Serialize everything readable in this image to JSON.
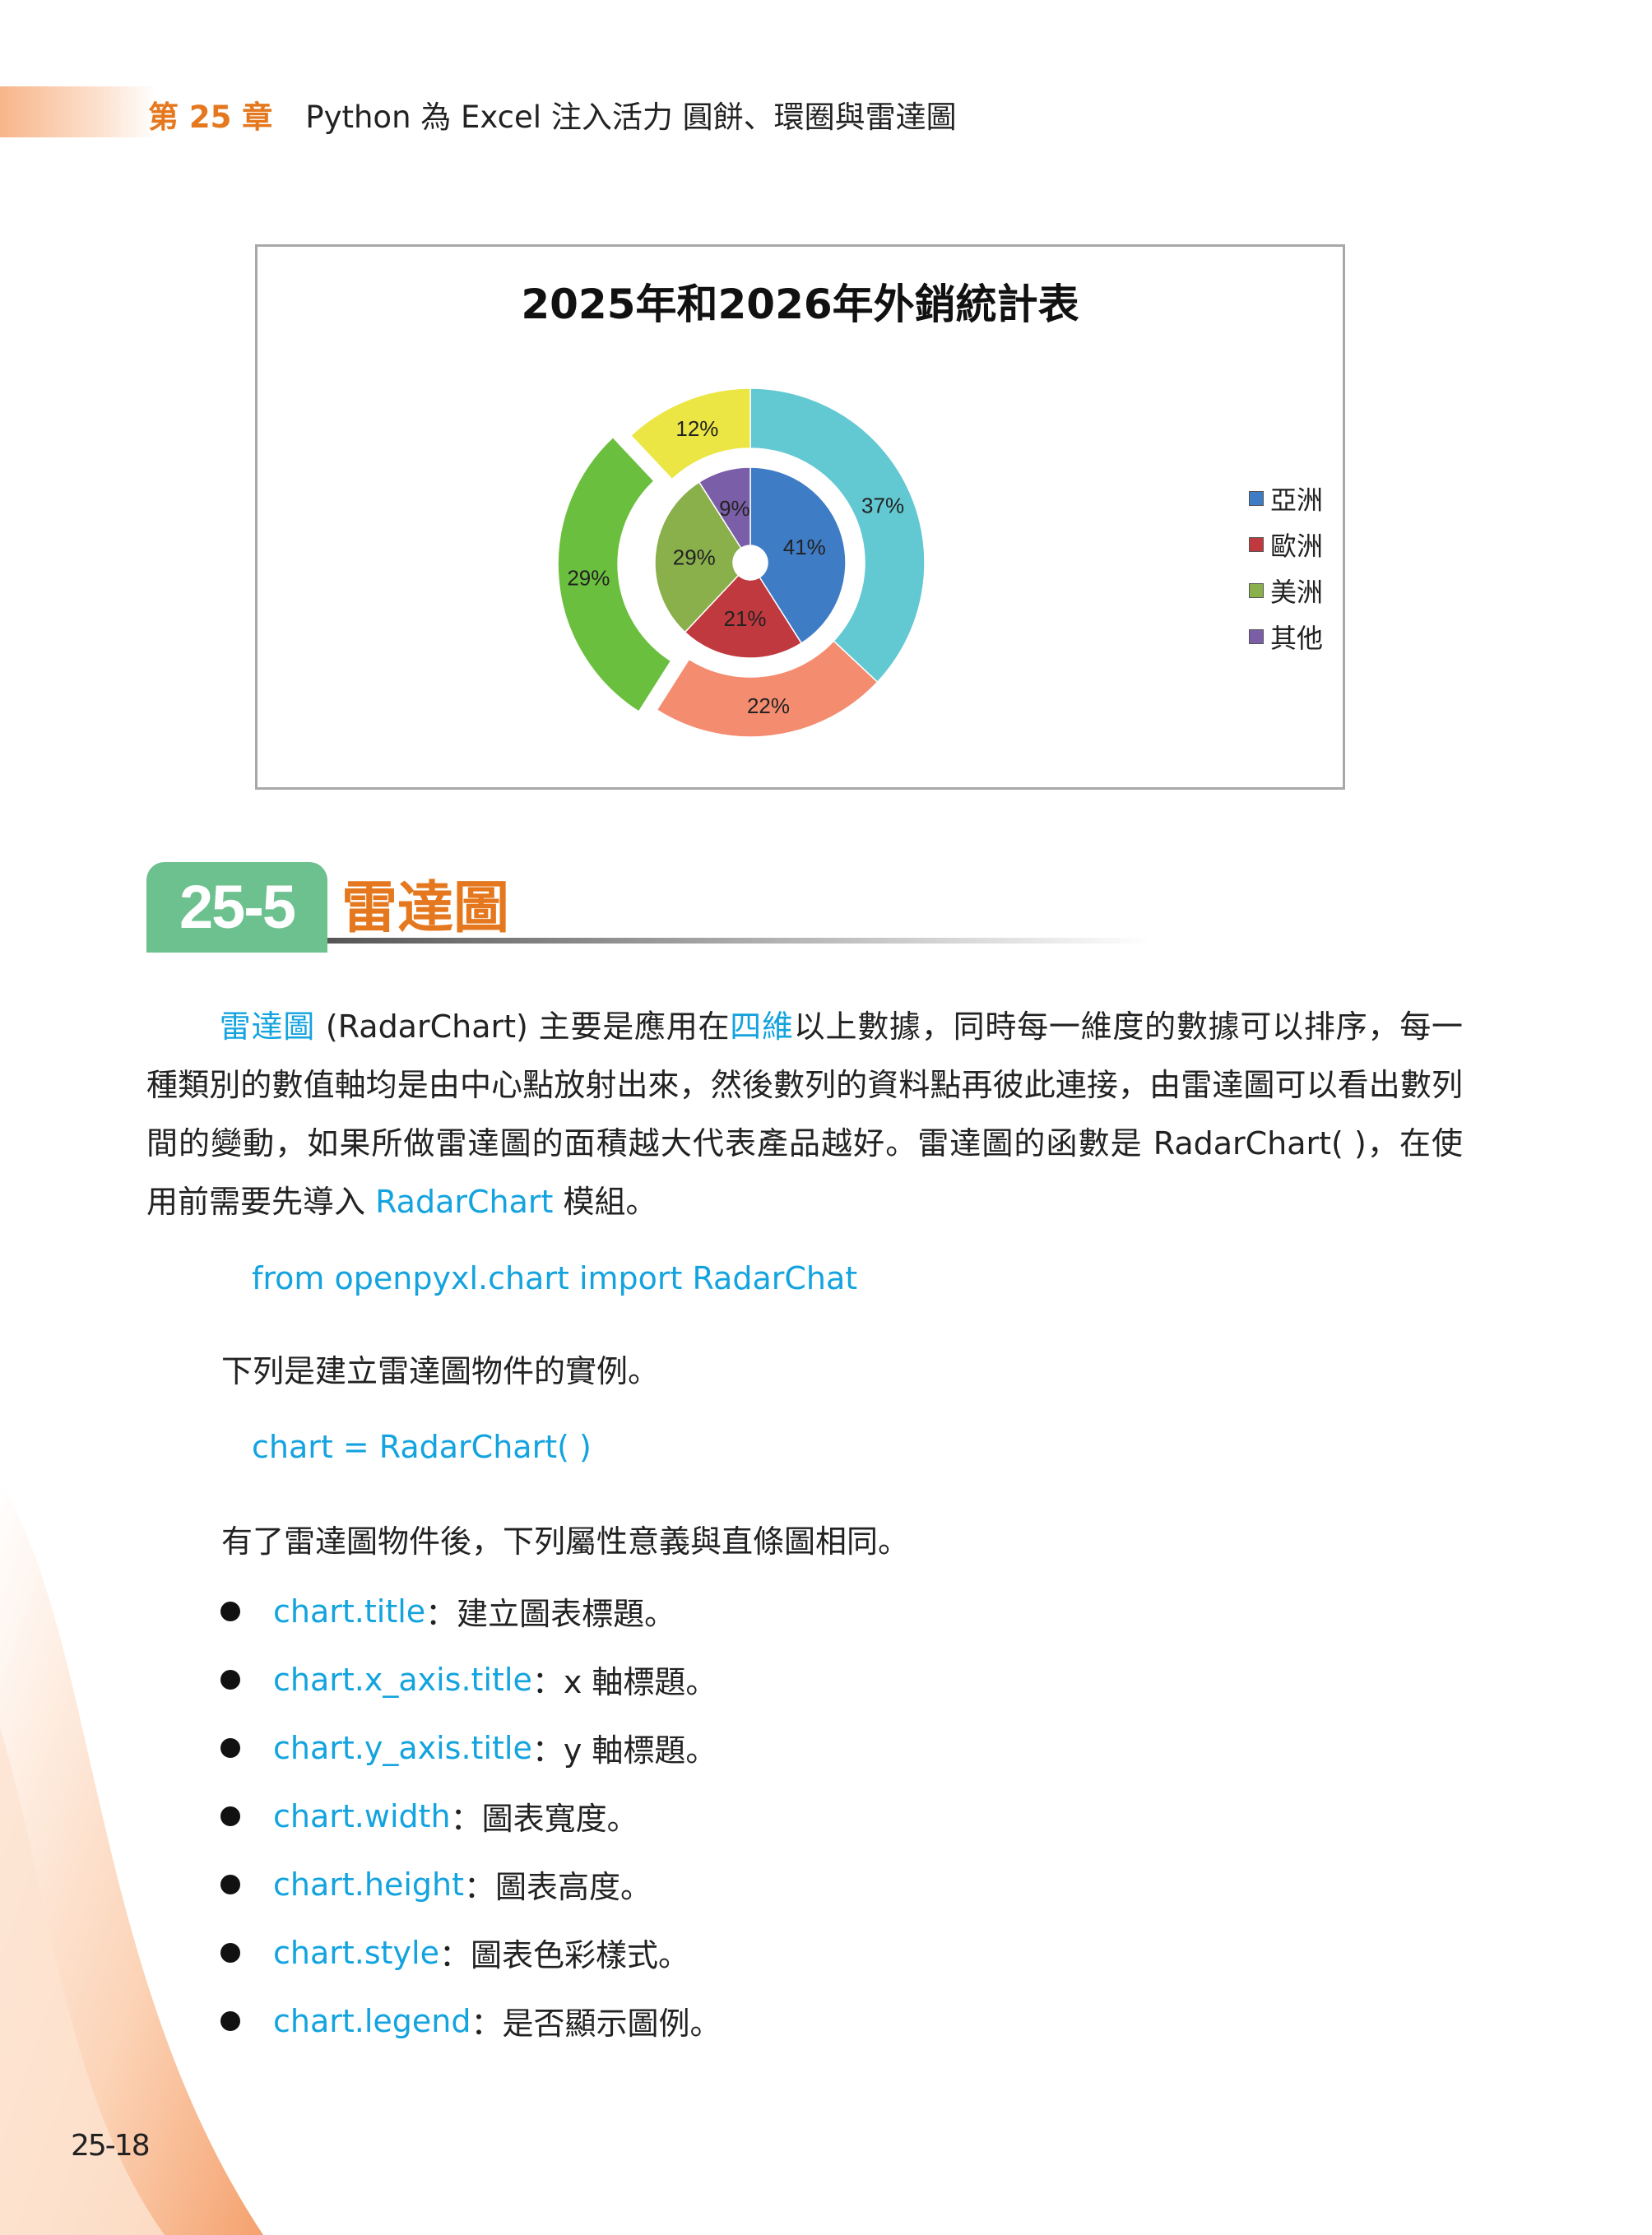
{
  "header": {
    "chapter": "第 25 章",
    "title": "Python 為 Excel 注入活力 圓餅、環圈與雷達圖"
  },
  "chart_data": {
    "type": "doughnut",
    "title": "2025年和2026年外銷統計表",
    "categories": [
      "亞洲",
      "歐洲",
      "美洲",
      "其他"
    ],
    "series": [
      {
        "ring": "inner",
        "values": [
          41,
          21,
          29,
          9
        ],
        "colors": [
          "#3f7cc6",
          "#c0393f",
          "#8ab04c",
          "#7b5ea8"
        ]
      },
      {
        "ring": "outer",
        "values": [
          37,
          22,
          29,
          12
        ],
        "colors": [
          "#62c8d2",
          "#f48c70",
          "#6bbf3e",
          "#ebe643"
        ],
        "exploded": [
          "美洲"
        ]
      }
    ],
    "data_label_format": "percent",
    "legend": "right",
    "legend_colors": [
      "#3f7cc6",
      "#c0393f",
      "#8ab04c",
      "#7b5ea8"
    ]
  },
  "section": {
    "number": "25-5",
    "title": "雷達圖"
  },
  "para": {
    "t1": "雷達圖",
    "t2": " (RadarChart) 主要是應用在",
    "t3": "四維",
    "t4": "以上數據，同時每一維度的數據可以排序，每一種類別的數值軸均是由中心點放射出來，然後數列的資料點再彼此連接，由雷達圖可以看出數列間的變動，如果所做雷達圖的面積越大代表產品越好。雷達圖的函數是 RadarChart( )，在使用前需要先導入 ",
    "t5": "RadarChart",
    "t6": " 模組。"
  },
  "code1": "from openpyxl.chart import RadarChat",
  "text1": "下列是建立雷達圖物件的實例。",
  "code2": "chart = RadarChart( )",
  "text2": "有了雷達圖物件後，下列屬性意義與直條圖相同。",
  "bullets": [
    {
      "code": "chart.title",
      "desc": "：建立圖表標題。"
    },
    {
      "code": "chart.x_axis.title",
      "desc": "：x 軸標題。"
    },
    {
      "code": "chart.y_axis.title",
      "desc": "：y 軸標題。"
    },
    {
      "code": "chart.width",
      "desc": "：圖表寬度。"
    },
    {
      "code": "chart.height",
      "desc": "：圖表高度。"
    },
    {
      "code": "chart.style",
      "desc": "：圖表色彩樣式。"
    },
    {
      "code": "chart.legend",
      "desc": "：是否顯示圖例。"
    }
  ],
  "page_number": "25-18"
}
